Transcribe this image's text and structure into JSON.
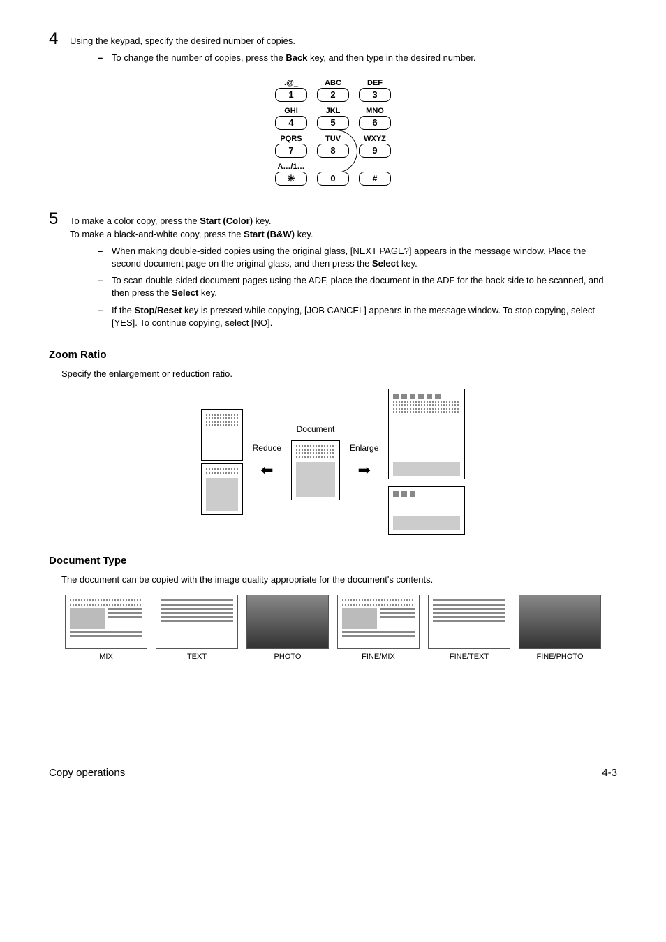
{
  "step4": {
    "num": "4",
    "text": "Using the keypad, specify the desired number of copies.",
    "bullet1_prefix": "To change the number of copies, press the ",
    "bullet1_key": "Back",
    "bullet1_suffix": " key, and then type in the desired number."
  },
  "keypad": {
    "r1": {
      "l1": ".@_",
      "k1": "1",
      "l2": "ABC",
      "k2": "2",
      "l3": "DEF",
      "k3": "3"
    },
    "r2": {
      "l1": "GHI",
      "k1": "4",
      "l2": "JKL",
      "k2": "5",
      "l3": "MNO",
      "k3": "6"
    },
    "r3": {
      "l1": "PQRS",
      "k1": "7",
      "l2": "TUV",
      "k2": "8",
      "l3": "WXYZ",
      "k3": "9"
    },
    "r4": {
      "l1": "A…/1…",
      "k1": "✳",
      "l2": "",
      "k2": "0",
      "l3": "",
      "k3": "#"
    }
  },
  "step5": {
    "num": "5",
    "line1_prefix": "To make a color copy, press the ",
    "line1_key": "Start (Color)",
    "line1_suffix": " key.",
    "line2_prefix": "To make a black-and-white copy, press the ",
    "line2_key": "Start (B&W)",
    "line2_suffix": " key.",
    "b1_prefix": "When making double-sided copies using the original glass, [NEXT PAGE?] appears in the message window. Place the second document page on the original glass, and then press the ",
    "b1_key": "Select",
    "b1_suffix": " key.",
    "b2_prefix": "To scan double-sided document pages using the ADF, place the document in the ADF for the back side to be scanned, and then press the ",
    "b2_key": "Select",
    "b2_suffix": " key.",
    "b3_prefix": "If the ",
    "b3_key": "Stop/Reset",
    "b3_suffix": " key is pressed while copying, [JOB CANCEL] appears in the message window. To stop copying, select [YES]. To continue copying, select [NO]."
  },
  "zoom": {
    "heading": "Zoom Ratio",
    "desc": "Specify the enlargement or reduction ratio.",
    "reduce": "Reduce",
    "document": "Document",
    "enlarge": "Enlarge"
  },
  "doctype": {
    "heading": "Document Type",
    "desc": "The document can be copied with the image quality appropriate for the document's contents.",
    "labels": [
      "MIX",
      "TEXT",
      "PHOTO",
      "FINE/MIX",
      "FINE/TEXT",
      "FINE/PHOTO"
    ]
  },
  "footer": {
    "left": "Copy operations",
    "right": "4-3"
  }
}
